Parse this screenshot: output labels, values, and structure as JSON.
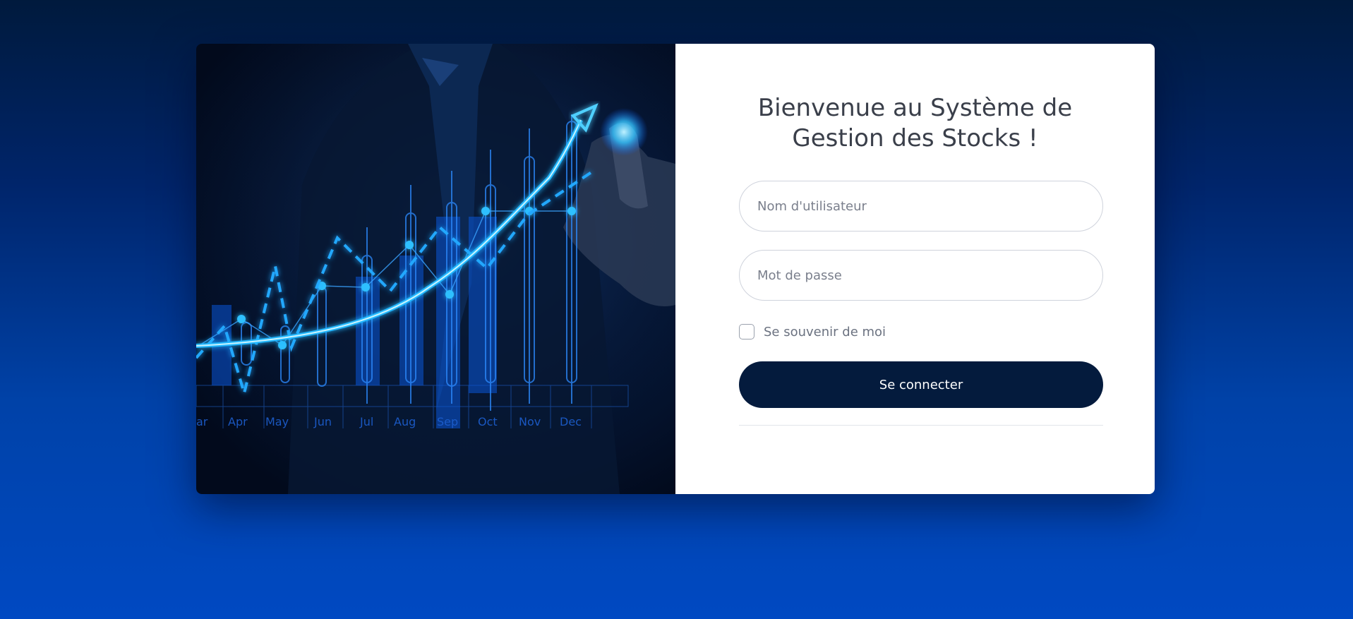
{
  "hero": {
    "month_labels": [
      "ar",
      "Apr",
      "May",
      "Jun",
      "Jul",
      "Aug",
      "Sep",
      "Oct",
      "Nov",
      "Dec"
    ]
  },
  "login": {
    "title_line1": "Bienvenue au Système de",
    "title_line2": "Gestion des Stocks !",
    "username_placeholder": "Nom d'utilisateur",
    "password_placeholder": "Mot de passe",
    "remember_label": "Se souvenir de moi",
    "remember_checked": false,
    "submit_label": "Se connecter"
  },
  "colors": {
    "button": "#041b3d",
    "glow": "#1fb6ff"
  }
}
